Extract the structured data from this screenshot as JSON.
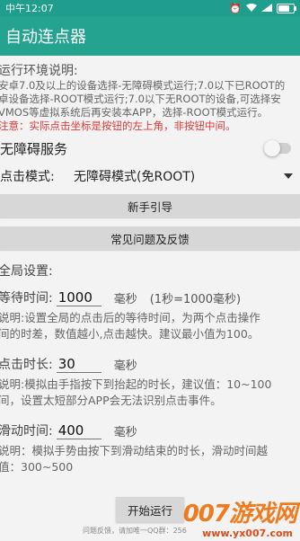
{
  "status_bar": {
    "time": "中午12:07"
  },
  "app_bar": {
    "title": "自动连点器"
  },
  "env": {
    "title": "运行环境说明:",
    "lines": [
      "安卓7.0及以上的设备选择-无障碍模式运行;7.0以下已ROOT的",
      "卓设备选择-ROOT模式运行;7.0以下无ROOT的设备,可选择安",
      "VMOS等虚拟系统后再安装本APP，选择-ROOT模式运行。"
    ],
    "note": "注意：实际点击坐标是按钮的左上角，非按钮中间。"
  },
  "service": {
    "label": "无障碍服务",
    "enabled": false
  },
  "mode": {
    "label": "点击模式:",
    "value": "无障碍模式(免ROOT)"
  },
  "buttons": {
    "guide": "新手引导",
    "faq": "常见问题及反馈",
    "start": "开始运行"
  },
  "global": {
    "title": "全局设置:",
    "wait": {
      "label": "等待时间:",
      "value": "1000",
      "unit": "毫秒",
      "hint": "(1秒=1000毫秒)",
      "desc": [
        "说明:设置全局的点击后的等待时间，为两个点击操作",
        "间的时差，数值越小,点击越快。建议最小值为100。"
      ]
    },
    "click_duration": {
      "label": "点击时长:",
      "value": "30",
      "unit": "毫秒",
      "desc": [
        "说明:模拟由手指按下到抬起的时长，建议值：10~100",
        "间，设置太短部分APP会无法识别点击事件。"
      ]
    },
    "swipe_duration": {
      "label": "滑动时间:",
      "value": "400",
      "unit": "毫秒",
      "desc": [
        "说明：模拟手势由按下到滑动结束的时长，滑动时间越",
        "值：300~500"
      ]
    }
  },
  "footer": {
    "text": "问题反馈，请加唯一QQ群：256"
  },
  "watermark": {
    "main": "007游戏网",
    "sub": "www.yx007.com"
  },
  "colors": {
    "statusbar": "#1f9e8e",
    "appbar": "#25a391",
    "note": "#e23a3a"
  }
}
